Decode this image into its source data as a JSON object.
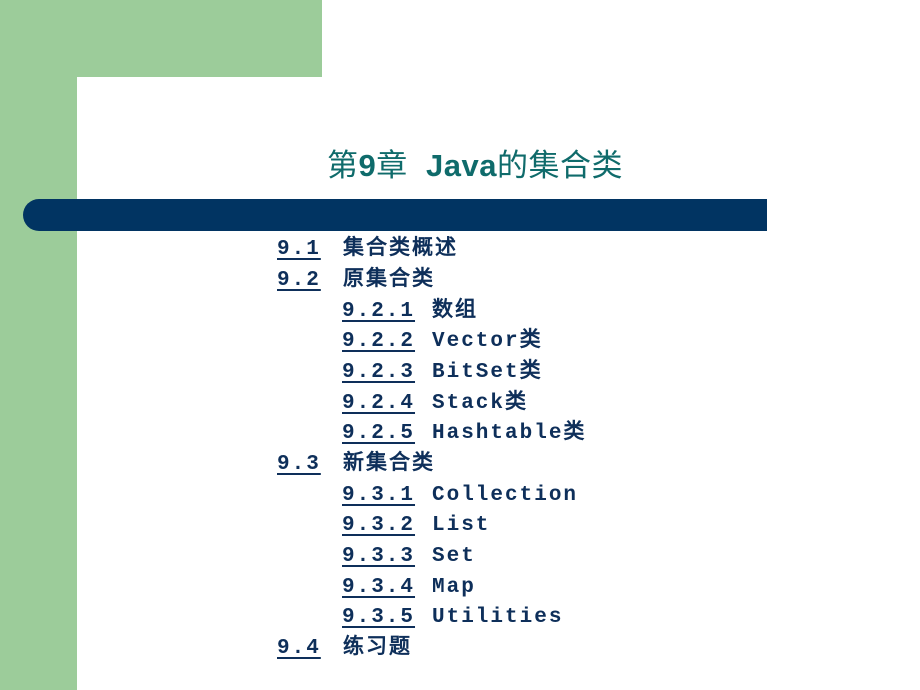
{
  "slide": {
    "title_prefix": "第",
    "title_chapter": "9",
    "title_mid": "章  ",
    "title_latin": "Java",
    "title_suffix": "的集合类",
    "colors": {
      "green": "#9ccc9a",
      "bar": "#013462",
      "title": "#0f6b6b",
      "text": "#0e2f5a"
    }
  },
  "toc": [
    {
      "num": "9.1",
      "text": "集合类概述",
      "level": 1
    },
    {
      "num": "9.2",
      "text": "原集合类",
      "level": 1
    },
    {
      "num": "9.2.1",
      "text": "数组",
      "level": 2
    },
    {
      "num": "9.2.2",
      "text": "Vector类",
      "level": 2
    },
    {
      "num": "9.2.3",
      "text": "BitSet类",
      "level": 2
    },
    {
      "num": "9.2.4",
      "text": "Stack类",
      "level": 2
    },
    {
      "num": "9.2.5",
      "text": "Hashtable类",
      "level": 2
    },
    {
      "num": "9.3",
      "text": "新集合类",
      "level": 1
    },
    {
      "num": "9.3.1",
      "text": "Collection",
      "level": 2
    },
    {
      "num": "9.3.2",
      "text": "List",
      "level": 2
    },
    {
      "num": "9.3.3",
      "text": "Set",
      "level": 2
    },
    {
      "num": "9.3.4",
      "text": "Map",
      "level": 2
    },
    {
      "num": "9.3.5",
      "text": "Utilities",
      "level": 2
    },
    {
      "num": "9.4",
      "text": "练习题",
      "level": 1
    }
  ]
}
